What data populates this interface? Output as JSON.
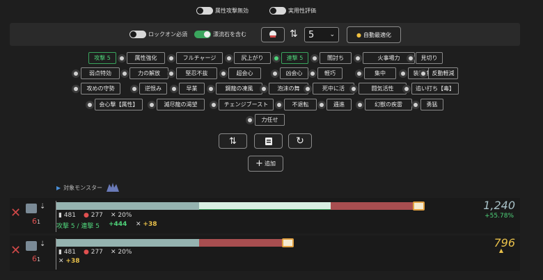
{
  "top_toggles": [
    {
      "label": "属性攻撃無効",
      "on": false
    },
    {
      "label": "実用性評価",
      "on": false
    }
  ],
  "options": {
    "lockon_label": "ロックオン必須",
    "fluid_label": "漂流石を含む",
    "select_value": "5",
    "auto_label": "自動最適化"
  },
  "skills": [
    "攻撃 5",
    "属性強化",
    "フルチャージ",
    "尻上がり",
    "連撃 5",
    "闇討ち",
    "火事場力",
    "見切り",
    "弱点特効",
    "力の解放",
    "堅忍不抜",
    "超会心",
    "凶会心",
    "軽巧",
    "集中",
    "装填速度",
    "反動軽減",
    "攻めの守勢",
    "逆恨み",
    "早業",
    "鋼龍の凍風",
    "泡沫の舞",
    "死中に活",
    "闘気活性",
    "追い打ち【毒】",
    "会心撃【属性】",
    "滅尽龍の渇望",
    "チェンジブースト",
    "不退転",
    "逓進",
    "幻獣の疾雷",
    "勇猛",
    "力任せ"
  ],
  "action_buttons": {
    "add_label": "追加"
  },
  "monster": {
    "label": "対象モンスター"
  },
  "builds": [
    {
      "level": "6",
      "sub": "1",
      "stat_a": "481",
      "stat_b": "277",
      "crit": "20%",
      "skill_summary": "攻撃 5 / 連撃 5",
      "bonus_a": "+444",
      "bonus_b": "+38",
      "score": "1,240",
      "delta": "+55.78%"
    },
    {
      "level": "6",
      "sub": "1",
      "stat_a": "481",
      "stat_b": "277",
      "crit": "20%",
      "bonus_b": "+38",
      "score": "796"
    }
  ],
  "colors": {
    "accent_green": "#3aa55d",
    "bar_teal": "#95b3b0",
    "bar_mint": "#d9efe3",
    "bar_red": "#a84e50",
    "score_gold": "#e8c04a",
    "score_gray": "#a9c2c8"
  }
}
